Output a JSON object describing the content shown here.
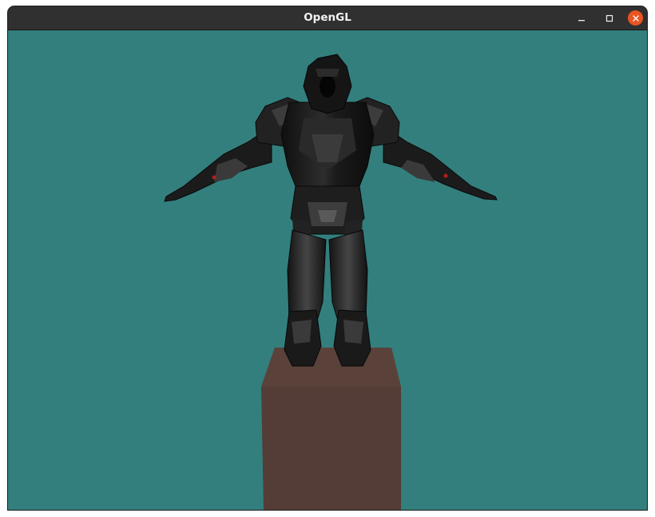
{
  "window": {
    "title": "OpenGL"
  },
  "controls": {
    "minimize_icon": "minimize-icon",
    "maximize_icon": "maximize-icon",
    "close_icon": "close-icon"
  },
  "colors": {
    "clear_color": "#337f7e",
    "pedestal": "#533d36",
    "close_button": "#e95420",
    "titlebar": "#303030"
  }
}
